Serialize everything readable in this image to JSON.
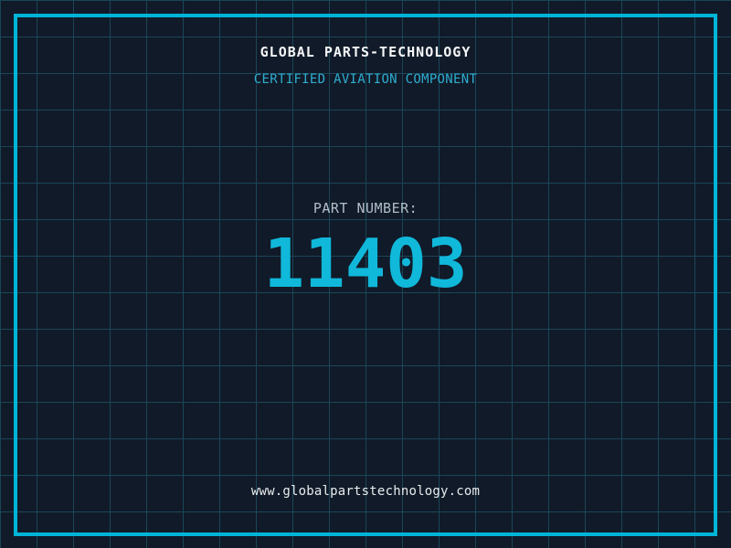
{
  "page": {
    "title": "GLOBAL PARTS-TECHNOLOGY",
    "subtitle": "CERTIFIED AVIATION COMPONENT",
    "part_number_label": "PART NUMBER:",
    "part_number": "11403",
    "website": "www.globalpartstechnology.com"
  },
  "colors": {
    "background": "#111a28",
    "grid_line": "#1a4659",
    "frame": "#00b5d8",
    "title_text": "#f5f7f8",
    "subtitle_text": "#2eaccf",
    "label_text": "#b0bfc9",
    "part_number_text": "#10b8da",
    "website_text": "#e8ecee"
  },
  "layout_meta": {
    "grid_spacing_px": "40"
  }
}
